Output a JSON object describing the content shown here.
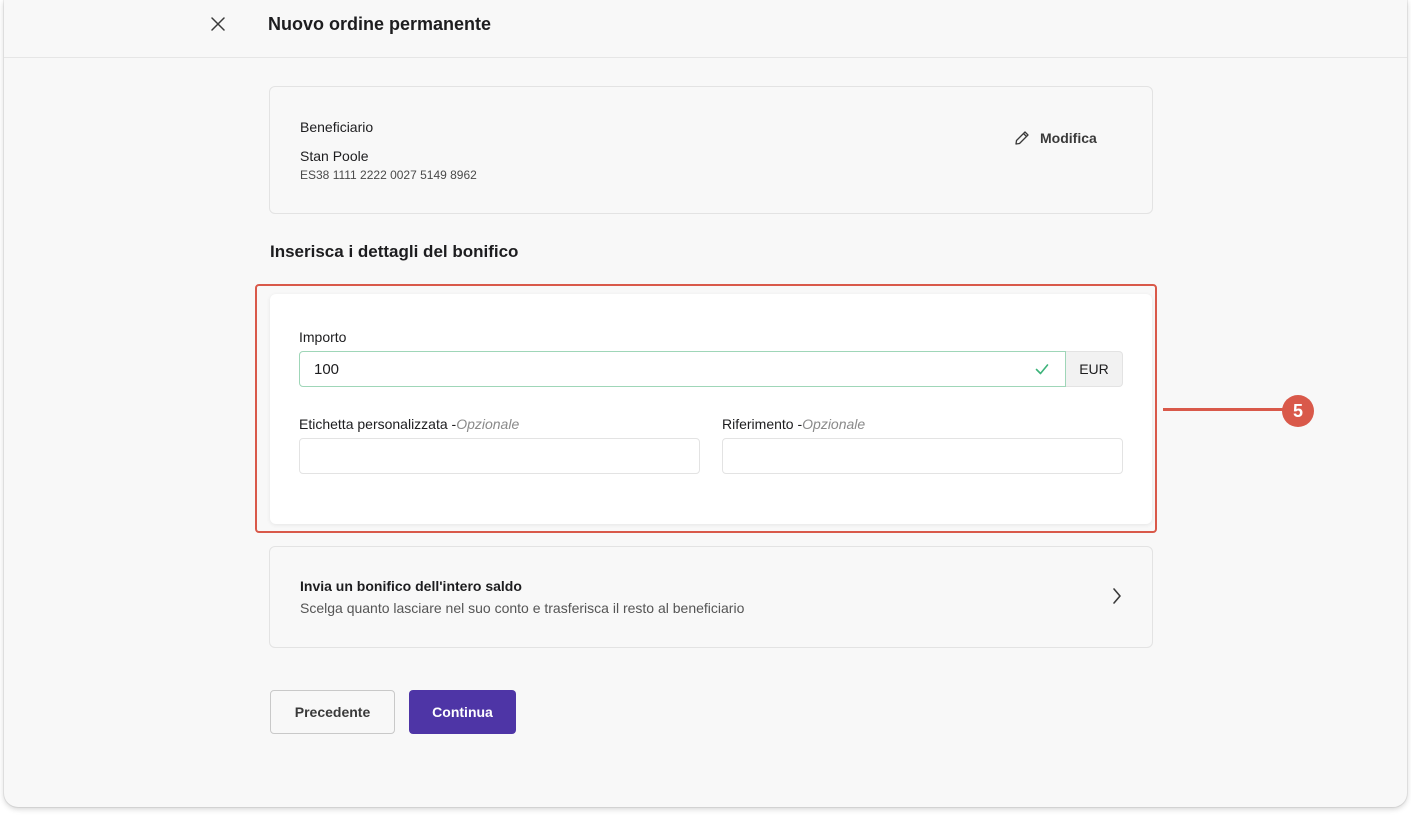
{
  "header": {
    "title": "Nuovo ordine permanente"
  },
  "beneficiary": {
    "label": "Beneficiario",
    "name": "Stan Poole",
    "iban": "ES38 1111 2222 0027 5149 8962",
    "edit_label": "Modifica"
  },
  "section": {
    "title": "Inserisca i dettagli del bonifico"
  },
  "form": {
    "amount_label": "Importo",
    "amount_value": "100",
    "currency": "EUR",
    "custom_label": "Etichetta personalizzata -",
    "custom_optional": "Opzionale",
    "custom_value": "",
    "reference_label": "Riferimento -",
    "reference_optional": "Opzionale",
    "reference_value": ""
  },
  "annotation": {
    "number": "5",
    "color": "#d9594a"
  },
  "full_balance": {
    "title": "Invia un bonifico dell'intero saldo",
    "description": "Scelga quanto lasciare nel suo conto e trasferisca il resto al beneficiario"
  },
  "buttons": {
    "previous": "Precedente",
    "continue": "Continua"
  },
  "colors": {
    "primary": "#4e35a6",
    "valid": "#9fd6b8",
    "annotation": "#d9594a"
  }
}
